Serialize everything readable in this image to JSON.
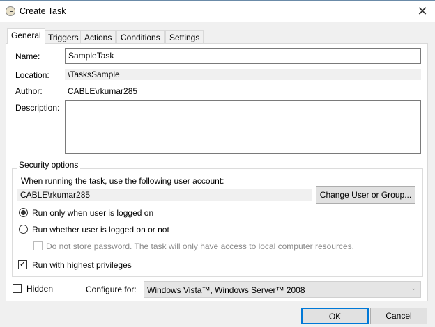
{
  "window": {
    "title": "Create Task",
    "icon": "clock-icon",
    "close": "✕"
  },
  "tabs": [
    {
      "label": "General"
    },
    {
      "label": "Triggers"
    },
    {
      "label": "Actions"
    },
    {
      "label": "Conditions"
    },
    {
      "label": "Settings"
    }
  ],
  "general": {
    "name_label": "Name:",
    "name_value": "SampleTask",
    "location_label": "Location:",
    "location_value": "\\TasksSample",
    "author_label": "Author:",
    "author_value": "CABLE\\rkumar285",
    "description_label": "Description:",
    "description_value": ""
  },
  "security": {
    "title": "Security options",
    "account_prompt": "When running the task, use the following user account:",
    "account_value": "CABLE\\rkumar285",
    "change_button": "Change User or Group...",
    "radio_logged_on": "Run only when user is logged on",
    "radio_whether": "Run whether user is logged on or not",
    "no_store_password": "Do not store password.  The task will only have access to local computer resources.",
    "highest_privileges": "Run with highest privileges",
    "selected_radio": "logged_on",
    "highest_checked": true,
    "no_store_checked": false
  },
  "hidden_label": "Hidden",
  "hidden_checked": false,
  "configure_label": "Configure for:",
  "configure_value": "Windows Vista™, Windows Server™ 2008",
  "buttons": {
    "ok": "OK",
    "cancel": "Cancel"
  }
}
